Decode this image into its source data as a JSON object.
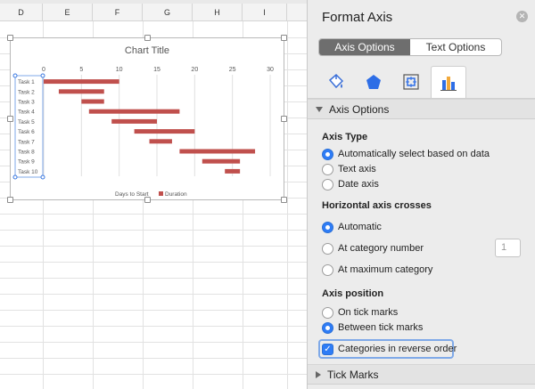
{
  "sheet": {
    "columns": [
      "D",
      "E",
      "F",
      "G",
      "H",
      "I"
    ]
  },
  "chart": {
    "title": "Chart Title",
    "legend": [
      "Days to Start",
      "Duration"
    ],
    "colors": {
      "duration": "#c0504d",
      "grid": "#e0e0e0",
      "axis_text": "#555555"
    }
  },
  "chart_data": {
    "type": "bar",
    "orientation": "horizontal",
    "stacked": true,
    "title": "Chart Title",
    "categories": [
      "Task 1",
      "Task 2",
      "Task 3",
      "Task 4",
      "Task 5",
      "Task 6",
      "Task 7",
      "Task 8",
      "Task 9",
      "Task 10"
    ],
    "series": [
      {
        "name": "Days to Start",
        "values": [
          0,
          2,
          5,
          6,
          9,
          12,
          14,
          18,
          21,
          24
        ],
        "color": "none"
      },
      {
        "name": "Duration",
        "values": [
          10,
          6,
          3,
          12,
          6,
          8,
          3,
          10,
          5,
          2
        ],
        "color": "#c0504d"
      }
    ],
    "xlim": [
      0,
      30
    ],
    "x_ticks": [
      0,
      5,
      10,
      15,
      20,
      25,
      30
    ],
    "reverse_categories": true,
    "grid": true,
    "legend_position": "bottom"
  },
  "pane": {
    "title": "Format Axis",
    "tabs": [
      "Axis Options",
      "Text Options"
    ],
    "icons": [
      "paint-bucket-icon",
      "pentagon-icon",
      "size-properties-icon",
      "bar-chart-icon"
    ],
    "section": "Axis Options",
    "axis_type": {
      "label": "Axis Type",
      "options": [
        "Automatically select based on data",
        "Text axis",
        "Date axis"
      ]
    },
    "crosses": {
      "label": "Horizontal axis crosses",
      "options": [
        "Automatic",
        "At category number",
        "At maximum category"
      ],
      "category_number": "1"
    },
    "position": {
      "label": "Axis position",
      "options": [
        "On tick marks",
        "Between tick marks"
      ]
    },
    "reverse_label": "Categories in reverse order",
    "tick_marks": "Tick Marks"
  }
}
